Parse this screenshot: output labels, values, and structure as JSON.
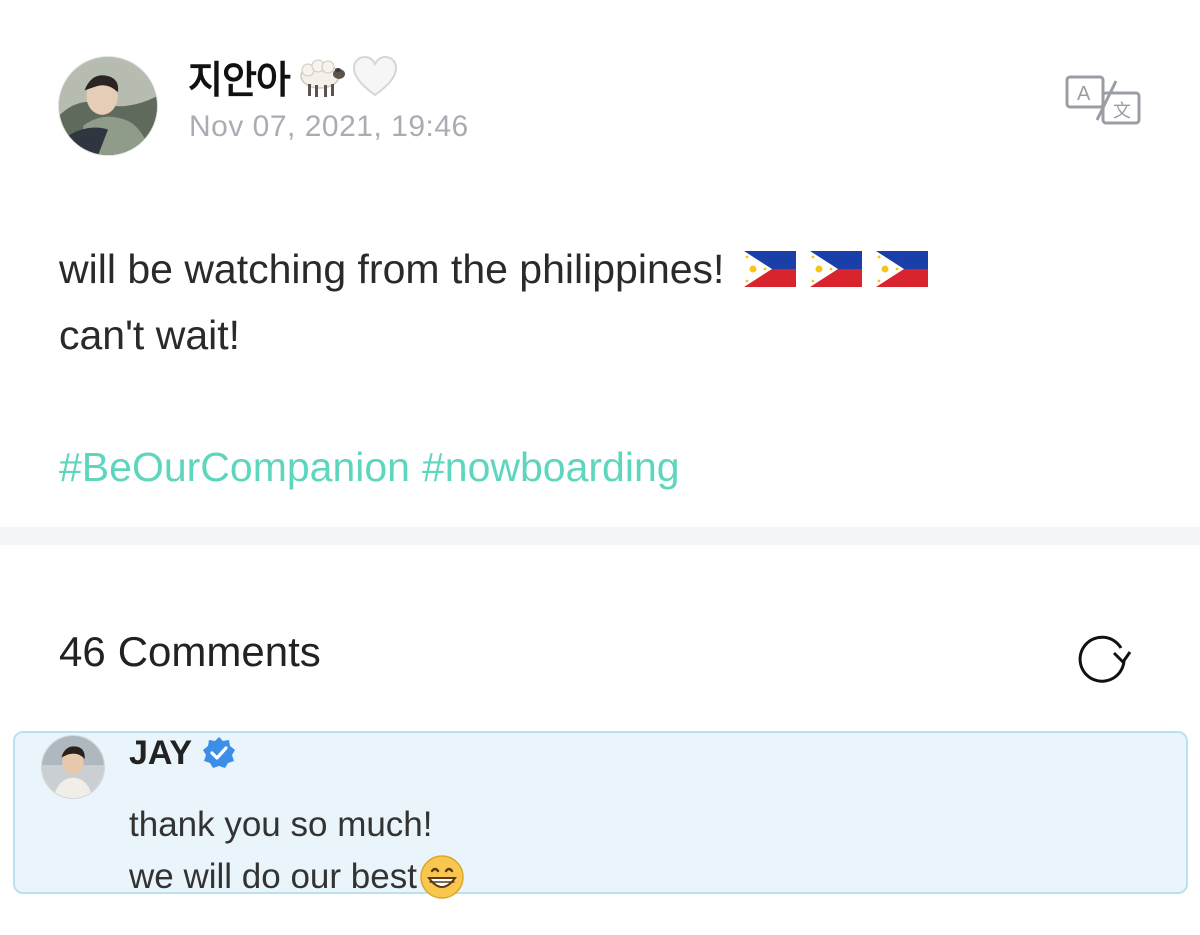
{
  "post": {
    "author": "지안아",
    "author_emojis": [
      "sheep-icon",
      "white-heart-icon"
    ],
    "timestamp": "Nov 07, 2021, 19:46",
    "body_lines": [
      "will be watching from the philippines!",
      "can't wait!"
    ],
    "flags": [
      "philippines-flag-icon",
      "philippines-flag-icon",
      "philippines-flag-icon"
    ],
    "hashtags": [
      "#BeOurCompanion",
      "#nowboarding"
    ],
    "translate_icon": "translate-icon"
  },
  "comments": {
    "count": "46",
    "label": "Comments",
    "refresh_icon": "refresh-icon",
    "items": [
      {
        "author": "JAY",
        "verified": true,
        "lines": [
          "thank you so much!",
          "we will do our best"
        ],
        "trailing_emoji": "grinning-face-icon"
      }
    ]
  },
  "colors": {
    "hashtag": "#5ed6bd",
    "timestamp": "#a9adb3",
    "comment_highlight_bg": "#e9f5fb",
    "comment_highlight_border": "#b9e1ef",
    "verified_badge": "#3d8ee8",
    "divider": "#f4f5f8"
  }
}
